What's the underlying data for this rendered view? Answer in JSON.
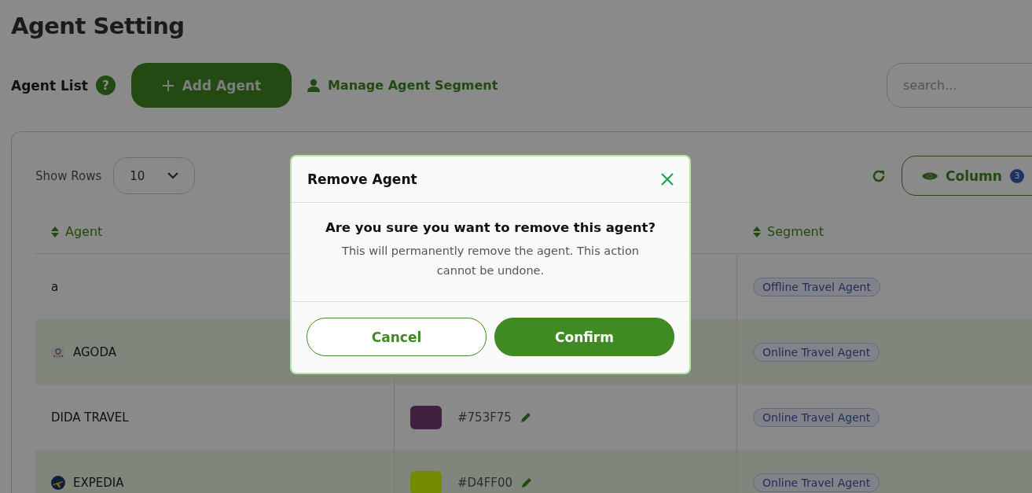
{
  "page_title": "Agent Setting",
  "toolbar": {
    "label": "Agent List",
    "help": "?",
    "add_button": "Add Agent",
    "segment_link": "Manage Agent Segment",
    "search": {
      "placeholder": "search..."
    }
  },
  "table_controls": {
    "show_rows_label": "Show Rows",
    "rows_value": "10",
    "column_button": "Column",
    "column_count": "3"
  },
  "table": {
    "columns": [
      {
        "label": "Agent",
        "sortable": true
      },
      {
        "label": "Segment",
        "sortable": true
      }
    ],
    "rows": [
      {
        "kind": "plain",
        "agent": "a",
        "segment": "Offline Travel Agent"
      },
      {
        "kind": "dots",
        "agent": "AGODA",
        "segment": "Online Travel Agent"
      },
      {
        "kind": "plain",
        "agent": "DIDA TRAVEL",
        "color_code": "#753F75",
        "segment": "Online Travel Agent"
      },
      {
        "kind": "plane",
        "agent": "EXPEDIA",
        "color_code": "#D4FF00",
        "segment": "Online Travel Agent"
      }
    ]
  },
  "dialog": {
    "title": "Remove Agent",
    "question": "Are you sure you want to remove this agent?",
    "message": "This will permanently remove the agent. This action cannot be undone.",
    "buttons": [
      {
        "label": "Cancel",
        "kind": "secondary"
      },
      {
        "label": "Confirm",
        "kind": "primary"
      }
    ]
  }
}
